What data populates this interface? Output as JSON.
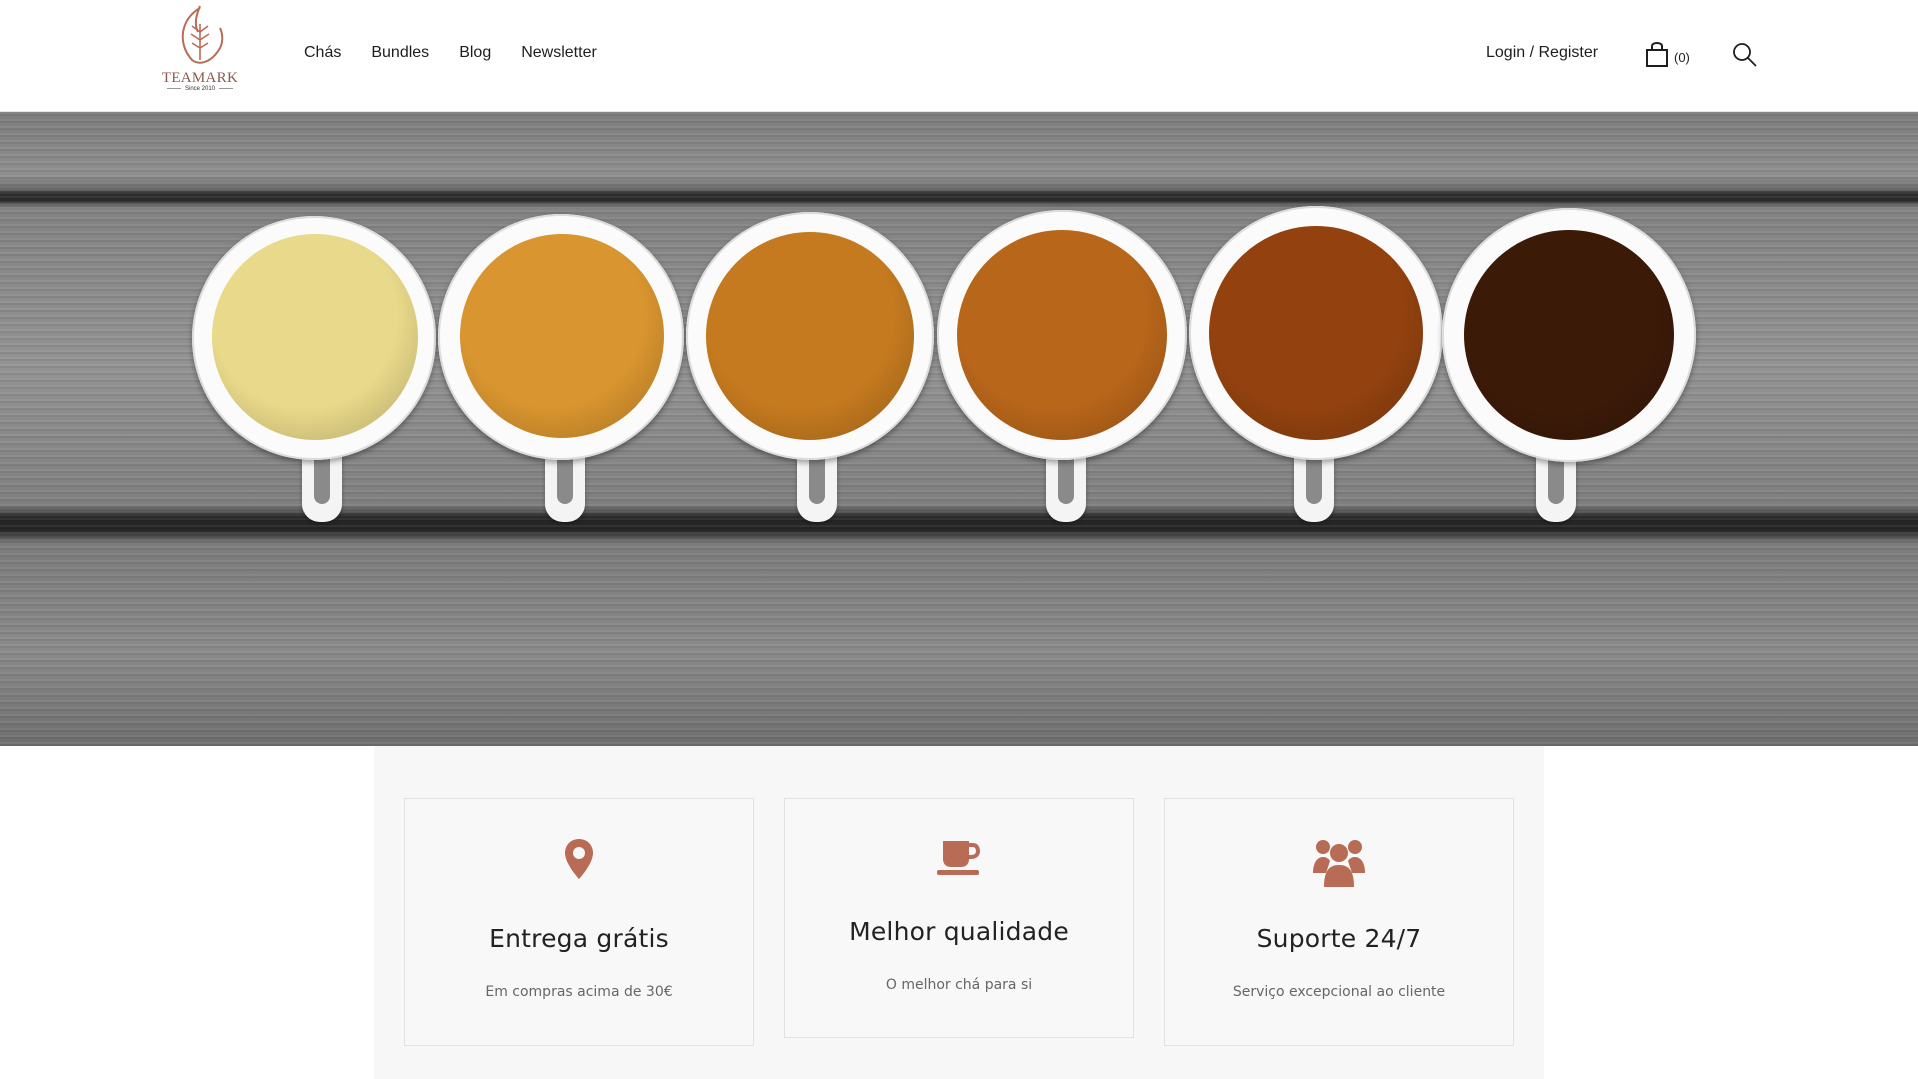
{
  "brand": {
    "name": "TEAMARK",
    "since": "Since 2010"
  },
  "nav": {
    "items": [
      "Chás",
      "Bundles",
      "Blog",
      "Newsletter"
    ]
  },
  "account": {
    "login_label": "Login / Register",
    "cart_count": "(0)"
  },
  "icons": {
    "cart": "shopping-bag-icon",
    "search": "search-icon"
  },
  "hero": {
    "cups": [
      "#e9d98a",
      "#d9952f",
      "#c57a1f",
      "#b8661a",
      "#93420f",
      "#3c1a08"
    ]
  },
  "features": [
    {
      "icon": "map-marker-icon",
      "title": "Entrega grátis",
      "subtitle": "Em compras acima de 30€"
    },
    {
      "icon": "coffee-cup-icon",
      "title": "Melhor qualidade",
      "subtitle": "O melhor chá para si"
    },
    {
      "icon": "users-group-icon",
      "title": "Suporte 24/7",
      "subtitle": "Serviço excepcional ao cliente"
    }
  ],
  "colors": {
    "accent": "#b86b55",
    "text": "#1e1e1e"
  }
}
